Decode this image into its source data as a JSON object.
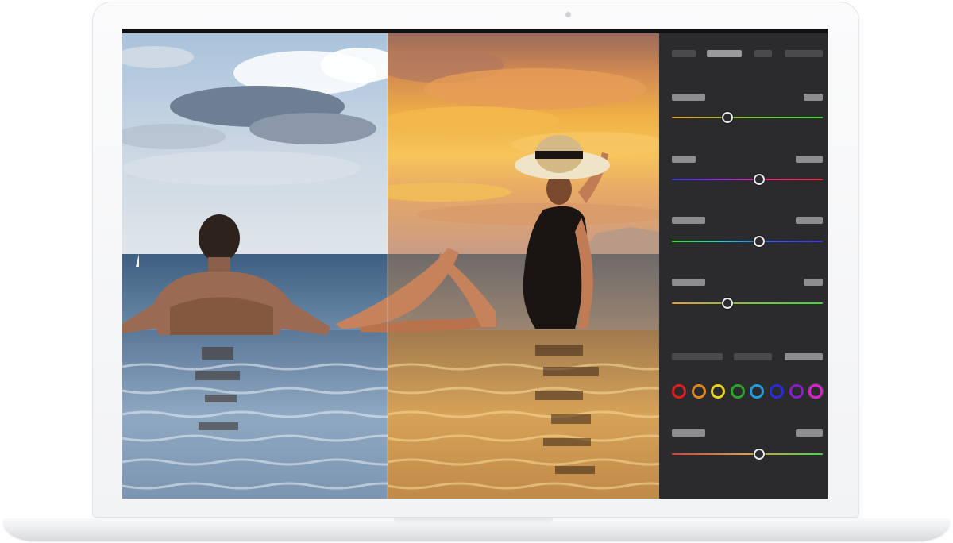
{
  "app": {
    "name": "photo-editor"
  },
  "panel": {
    "tab_count": 4,
    "sliders": [
      {
        "name": "slider-1",
        "level": 0.37,
        "gradient": [
          "#e0a03a",
          "#7fbf3a",
          "#3ddc3a"
        ]
      },
      {
        "name": "slider-2",
        "level": 0.58,
        "gradient": [
          "#3a3ad6",
          "#9b2fd6",
          "#e0307a",
          "#e0303a"
        ]
      },
      {
        "name": "slider-3",
        "level": 0.58,
        "gradient": [
          "#3ddc3a",
          "#3ac6c6",
          "#3a5ae0",
          "#3a3ad6"
        ]
      },
      {
        "name": "slider-4",
        "level": 0.37,
        "gradient": [
          "#e0a03a",
          "#7fbf3a",
          "#3ddc3a"
        ]
      },
      {
        "name": "slider-5",
        "level": 0.58,
        "gradient": [
          "#e03a3a",
          "#e0a03a",
          "#3ddc3a"
        ]
      }
    ],
    "color_swatches": [
      {
        "name": "red",
        "color": "#e01e1e"
      },
      {
        "name": "orange",
        "color": "#e08a1e"
      },
      {
        "name": "yellow",
        "color": "#e6d21e"
      },
      {
        "name": "green",
        "color": "#2aa52a"
      },
      {
        "name": "aqua",
        "color": "#1e9ee0"
      },
      {
        "name": "blue",
        "color": "#2a2ae0"
      },
      {
        "name": "purple",
        "color": "#8a1ec8"
      },
      {
        "name": "magenta",
        "color": "#e01ed2"
      }
    ],
    "active_swatch": "magenta"
  },
  "photo": {
    "comparison_split": 0.49,
    "before_tone": "cool",
    "after_tone": "warm-sunset"
  }
}
